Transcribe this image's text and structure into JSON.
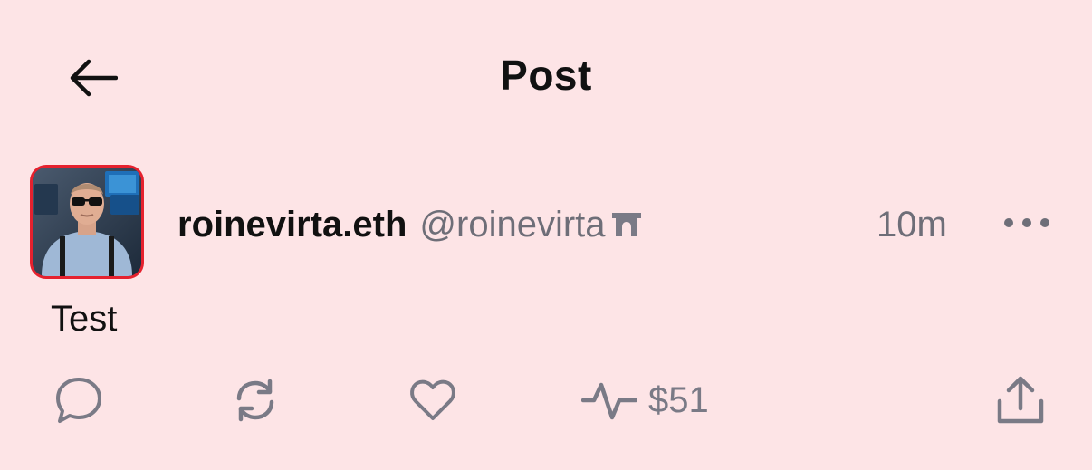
{
  "header": {
    "title": "Post",
    "back_icon": "arrow-left-icon"
  },
  "post": {
    "author": {
      "display_name": "roinevirta.eth",
      "handle": "@roinevirta",
      "badge_icon": "arch-badge-icon",
      "avatar_border_color": "#E5212E"
    },
    "timestamp": "10m",
    "more_icon": "ellipsis-icon",
    "text": "Test",
    "actions": {
      "reply_icon": "comment-bubble-icon",
      "recast_icon": "recast-arrows-icon",
      "like_icon": "heart-icon",
      "tips_icon": "activity-pulse-icon",
      "tips_amount": "$51",
      "share_icon": "share-upload-icon"
    }
  },
  "colors": {
    "background": "#FDE4E6",
    "text_primary": "#111111",
    "text_secondary": "#6E6E78",
    "icon_gray": "#7A7A86",
    "accent_red": "#E5212E"
  }
}
